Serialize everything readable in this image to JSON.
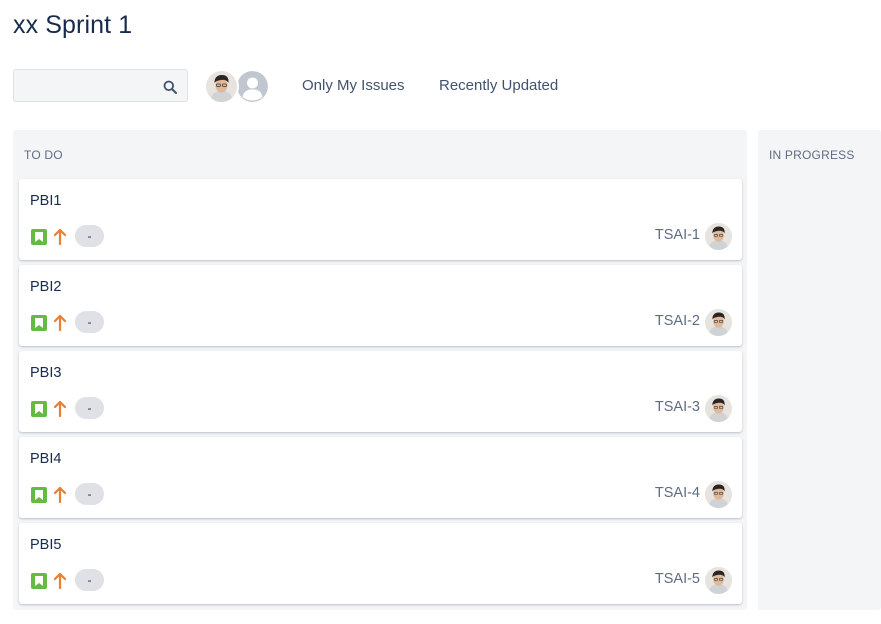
{
  "board": {
    "title": "xx Sprint 1"
  },
  "toolbar": {
    "search_placeholder": "",
    "search_value": "",
    "filters": {
      "only_my_issues": "Only My Issues",
      "recently_updated": "Recently Updated"
    }
  },
  "columns": {
    "todo": {
      "name": "TO DO"
    },
    "in_progress": {
      "name": "IN PROGRESS"
    }
  },
  "cards": [
    {
      "summary": "PBI1",
      "key": "TSAI-1",
      "estimate": "-",
      "issue_type_icon": "story-icon",
      "priority_icon": "priority-high-arrow-icon"
    },
    {
      "summary": "PBI2",
      "key": "TSAI-2",
      "estimate": "-",
      "issue_type_icon": "story-icon",
      "priority_icon": "priority-high-arrow-icon"
    },
    {
      "summary": "PBI3",
      "key": "TSAI-3",
      "estimate": "-",
      "issue_type_icon": "story-icon",
      "priority_icon": "priority-high-arrow-icon"
    },
    {
      "summary": "PBI4",
      "key": "TSAI-4",
      "estimate": "-",
      "issue_type_icon": "story-icon",
      "priority_icon": "priority-high-arrow-icon"
    },
    {
      "summary": "PBI5",
      "key": "TSAI-5",
      "estimate": "-",
      "issue_type_icon": "story-icon",
      "priority_icon": "priority-high-arrow-icon"
    }
  ],
  "colors": {
    "story": "#65ba43",
    "priority_high": "#e97f33",
    "column_bg": "#f4f5f7",
    "text_primary": "#172b4d",
    "text_secondary": "#5e6c84"
  }
}
